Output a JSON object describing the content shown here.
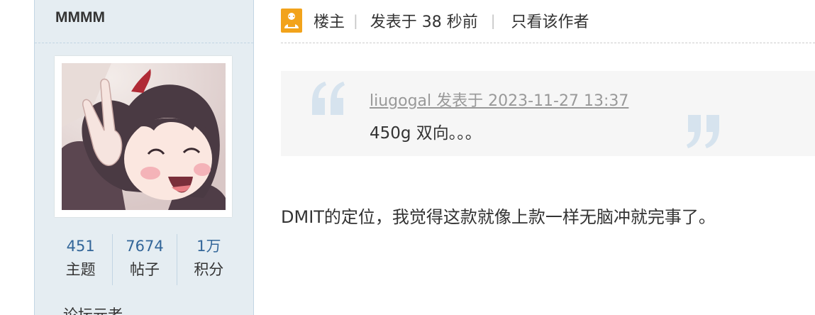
{
  "author": {
    "username": "MMMM",
    "stats": [
      {
        "value": "451",
        "label": "主题"
      },
      {
        "value": "7674",
        "label": "帖子"
      },
      {
        "value": "1万",
        "label": "积分"
      }
    ],
    "rank_partial": "论坛元老"
  },
  "post_header": {
    "owner_label": "楼主",
    "posted_time": "发表于 38 秒前",
    "only_author_link": "只看该作者"
  },
  "quote": {
    "meta": "liugogal 发表于 2023-11-27 13:37",
    "text": "450g 双向。。。"
  },
  "post": {
    "body": "DMIT的定位，我觉得这款就像上款一样无脑冲就完事了。"
  },
  "colors": {
    "sidebar_bg": "#e5edf2",
    "stat_value": "#336699",
    "owner_badge": "#f2a31b"
  }
}
